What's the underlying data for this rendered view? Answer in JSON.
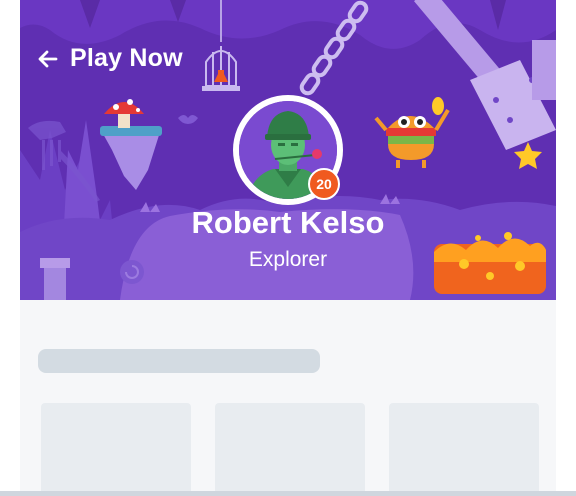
{
  "header": {
    "back_label": "Play Now"
  },
  "profile": {
    "name": "Robert Kelso",
    "role": "Explorer",
    "level": "20"
  },
  "icons": [
    "arrow-left-icon",
    "soldier-avatar",
    "cage-icon",
    "mushroom-icon",
    "monster-icon",
    "star-icon",
    "chain-icon",
    "lava-icon"
  ],
  "colors": {
    "hero_background": "#5f2fb2",
    "badge": "#f05a1f",
    "skeleton": "#d3dbe2"
  },
  "loading": {
    "cards": [
      {
        "id": "card-1"
      },
      {
        "id": "card-2"
      },
      {
        "id": "card-3"
      }
    ]
  }
}
